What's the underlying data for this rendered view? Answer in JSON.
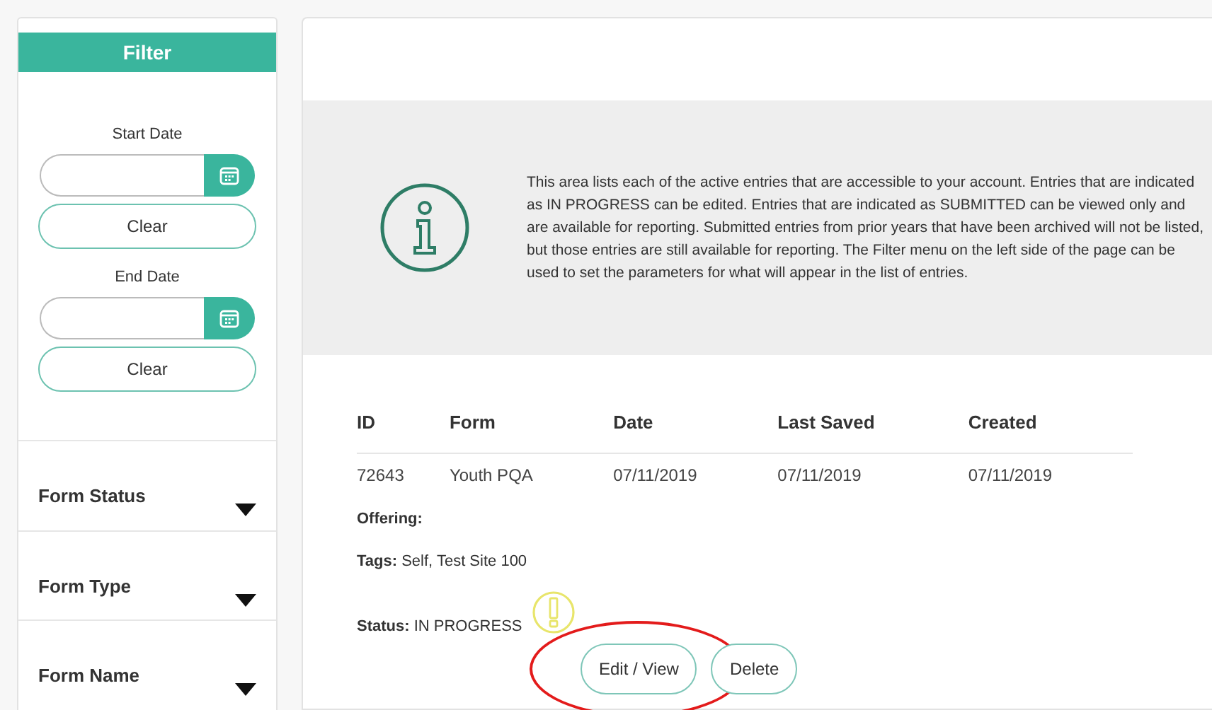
{
  "sidebar": {
    "title": "Filter",
    "date_filters": [
      {
        "label": "Start Date",
        "clear_button": "Clear"
      },
      {
        "label": "End Date",
        "clear_button": "Clear"
      }
    ],
    "sections": [
      {
        "label": "Form Status",
        "expanded": false
      },
      {
        "label": "Form Type",
        "expanded": false
      },
      {
        "label": "Form Name",
        "expanded": false
      }
    ]
  },
  "info": {
    "text": "This area lists each of the active entries that are accessible to your account. Entries that are indicated as IN PROGRESS can be edited. Entries that are indicated as SUBMITTED can be viewed only and are available for reporting. Submitted entries from prior years that have been archived will not be listed, but those entries are still available for reporting. The Filter menu on the left side of the page can be used to set the parameters for what will appear in the list of entries."
  },
  "table": {
    "columns": [
      "ID",
      "Form",
      "Date",
      "Last Saved",
      "Created"
    ],
    "rows": [
      [
        "72643",
        "Youth PQA",
        "07/11/2019",
        "07/11/2019",
        "07/11/2019"
      ]
    ]
  },
  "entry": {
    "offering": "Offering:",
    "tags": "**Tags:** Self, Test Site 100",
    "status": "**Status:** IN PROGRESS",
    "status_flagged": true,
    "buttons": [
      {
        "label": "Edit / View",
        "highlighted": true
      },
      {
        "label": "Delete",
        "highlighted": false
      }
    ]
  }
}
